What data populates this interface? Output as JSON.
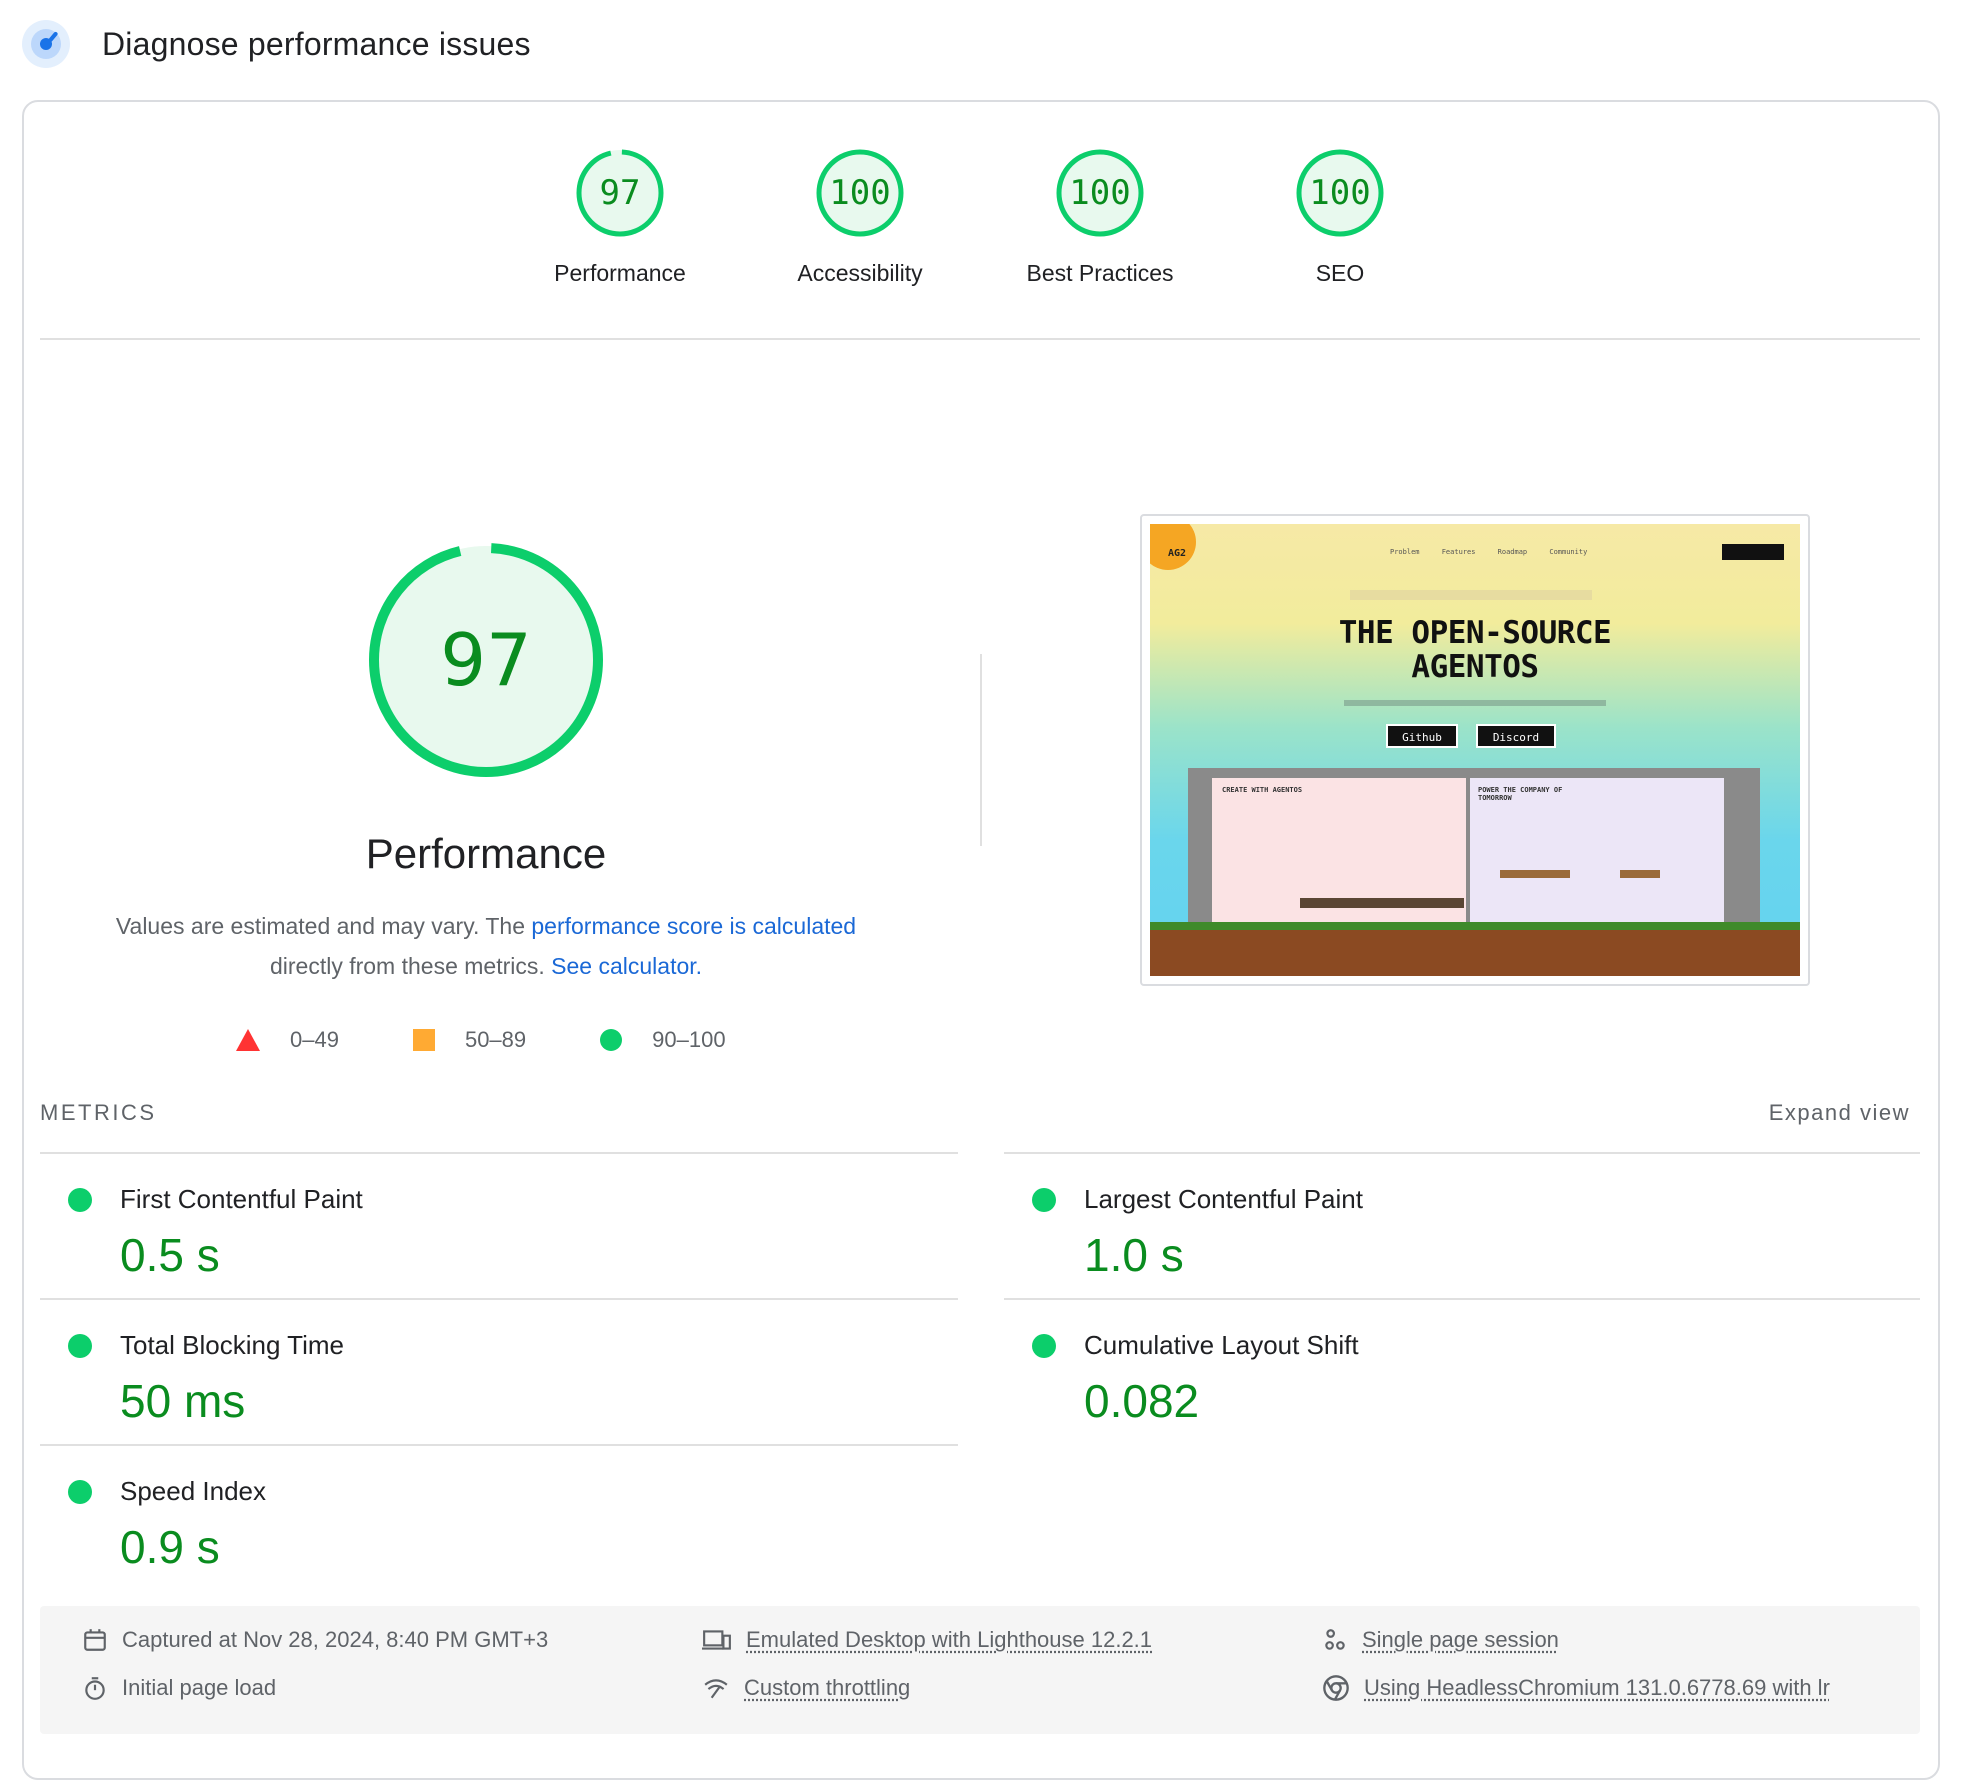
{
  "header": {
    "title": "Diagnose performance issues",
    "icon": "lighthouse-gauge-icon"
  },
  "categories": [
    {
      "label": "Performance",
      "score": "97",
      "score_value": 97
    },
    {
      "label": "Accessibility",
      "score": "100",
      "score_value": 100
    },
    {
      "label": "Best Practices",
      "score": "100",
      "score_value": 100
    },
    {
      "label": "SEO",
      "score": "100",
      "score_value": 100
    }
  ],
  "summary": {
    "score": "97",
    "score_value": 97,
    "title": "Performance",
    "desc_prefix": "Values are estimated and may vary. The ",
    "desc_link": "performance score is calculated",
    "desc_middle": " directly from these metrics. ",
    "calc_link": "See calculator."
  },
  "legend": [
    {
      "range": "0–49",
      "shape": "triangle",
      "color": "#ff3333"
    },
    {
      "range": "50–89",
      "shape": "square",
      "color": "#ffaa33"
    },
    {
      "range": "90–100",
      "shape": "circle",
      "color": "#0cce6b"
    }
  ],
  "thumbnail": {
    "logo": "AG2",
    "nav": "Problem Features Roadmap Community",
    "hero_line1": "THE OPEN-SOURCE",
    "hero_line2": "AGENTOS",
    "button_github": "Github",
    "button_discord": "Discord",
    "panel_left": "CREATE WITH AGENTOS",
    "panel_right": "POWER THE COMPANY OF TOMORROW"
  },
  "metrics": {
    "label": "METRICS",
    "expand": "Expand view",
    "items": [
      {
        "name": "First Contentful Paint",
        "value": "0.5 s"
      },
      {
        "name": "Largest Contentful Paint",
        "value": "1.0 s"
      },
      {
        "name": "Total Blocking Time",
        "value": "50 ms"
      },
      {
        "name": "Cumulative Layout Shift",
        "value": "0.082"
      },
      {
        "name": "Speed Index",
        "value": "0.9 s"
      }
    ]
  },
  "info": {
    "captured": "Captured at Nov 28, 2024, 8:40 PM GMT+3",
    "load": "Initial page load",
    "device": "Emulated Desktop with Lighthouse 12.2.1",
    "throttling": "Custom throttling",
    "session": "Single page session",
    "browser": "Using HeadlessChromium 131.0.6778.69 with lr"
  },
  "colors": {
    "pass": "#0cce6b",
    "pass_text": "#0a8c1f",
    "pass_fill": "#e8f9ee",
    "link": "#1a68d6"
  }
}
